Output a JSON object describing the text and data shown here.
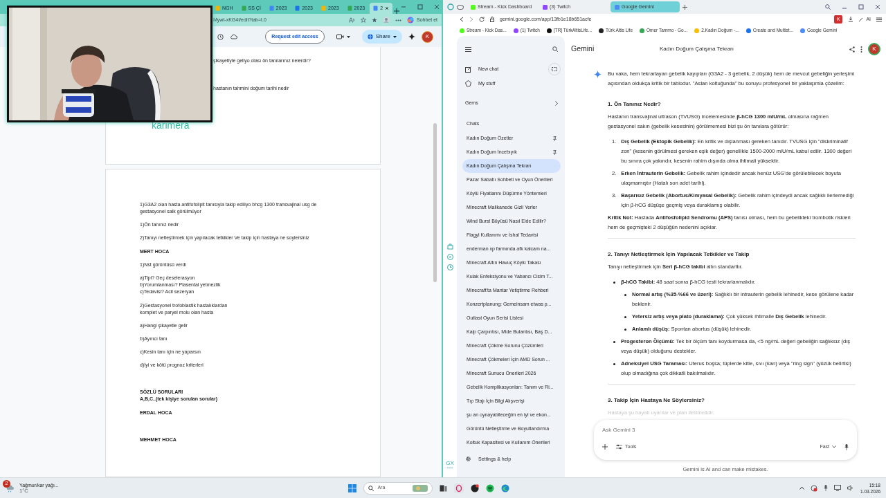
{
  "left_browser": {
    "tabs": [
      {
        "label": "NGH",
        "selected": false
      },
      {
        "label": "SS Çİ",
        "selected": false
      },
      {
        "label": "2023",
        "selected": false
      },
      {
        "label": "2023",
        "selected": false
      },
      {
        "label": "2023",
        "selected": false
      },
      {
        "label": "2023",
        "selected": false
      },
      {
        "label": "2",
        "selected": true
      }
    ],
    "url": "Mywt-xKG4I/edit?tab=t.0",
    "copilot_label": "Sohbet et"
  },
  "docs_toolbar": {
    "request_button": "Request edit access",
    "share_button": "Share",
    "avatar": "K"
  },
  "doc": {
    "page1_lines": [
      "şikayetiyle geliyo olası ön tanılarınız nelerdir?",
      "hastanın tahmini doğum tarihi nedir"
    ],
    "logo": "karimera",
    "page2_blocks": [
      {
        "kind": "para",
        "bold": false,
        "lines": [
          "1)G3A2 olan hasta antifofolipit tanısıyla takip ediliyo bhcg 1300 transvajinal usg de",
          "gestasyonel salk görülmüyor"
        ]
      },
      {
        "kind": "para",
        "bold": false,
        "lines": [
          "1)Ön tanınız nedir"
        ]
      },
      {
        "kind": "para",
        "bold": false,
        "lines": [
          "2)Tanıyı netleştirmek için yapılacak tetkikler Ve takip için hastaya ne soylersiniz"
        ]
      },
      {
        "kind": "section",
        "bold": true,
        "lines": [
          "MERT HOCA"
        ]
      },
      {
        "kind": "para",
        "bold": false,
        "lines": [
          "1)Nst görüntüsü verdi"
        ]
      },
      {
        "kind": "para",
        "bold": false,
        "lines": [
          "a)Tipi? Geç deselerasyon",
          "b)Yorumlanması? Plasental yetmezlik",
          "c)Tedavisi? Acil sezeryan"
        ]
      },
      {
        "kind": "section",
        "bold": false,
        "lines": [
          "2)Gestasyonel trofoblastik hastalıklardan",
          "komplet ve paryel molu olan hasta"
        ]
      },
      {
        "kind": "para",
        "bold": false,
        "lines": [
          "a)Hangi şikayetle gelir"
        ]
      },
      {
        "kind": "para",
        "bold": false,
        "lines": [
          "b)Ayırıcı tanı"
        ]
      },
      {
        "kind": "para",
        "bold": false,
        "lines": [
          "c)Kesin tanı için ne yaparsın"
        ]
      },
      {
        "kind": "para",
        "bold": false,
        "lines": [
          "d)İyi ve kötü prognoz kriterleri"
        ]
      },
      {
        "kind": "part",
        "bold": true,
        "lines": [
          "SÖZLÜ SORULARI",
          "A,B,C..(tek kişiye sorulan sorular)"
        ]
      },
      {
        "kind": "section",
        "bold": true,
        "lines": [
          "ERDAL HOCA"
        ]
      },
      {
        "kind": "part",
        "bold": true,
        "lines": [
          "MEHMET HOCA"
        ]
      }
    ]
  },
  "right_browser": {
    "tabs": [
      {
        "label": "Stream - Kick Dashboard",
        "selected": false
      },
      {
        "label": "(3) Twitch",
        "selected": false
      },
      {
        "label": "Google Gemini",
        "selected": true
      }
    ],
    "url": "gemini.google.com/app/13fb1e18b651acfe",
    "profile": "K",
    "ai_label": "AI",
    "side_label": "GX",
    "bookmarks": [
      "Stream - Kick Das...",
      "(1) Twitch",
      "[TR] TürkAltisLife...",
      "Türk Altis Life",
      "Ömer Tammo - Go...",
      "2.Kadın Doğum -...",
      "Create and Multist...",
      "Google Gemini"
    ]
  },
  "gemini": {
    "brand": "Gemini",
    "chat_title": "Kadın Doğum Çalışma Tekrarı",
    "avatar": "K",
    "sidebar": {
      "new_chat": "New chat",
      "my_stuff": "My stuff",
      "gems": "Gems",
      "chats_heading": "Chats",
      "settings": "Settings & help",
      "chats": [
        {
          "label": "Kadın Doğum Özetler",
          "pinned": true,
          "selected": false
        },
        {
          "label": "Kadın Doğum İncebıyık",
          "pinned": true,
          "selected": false
        },
        {
          "label": "Kadın Doğum Çalışma Tekrarı",
          "pinned": false,
          "selected": true
        },
        {
          "label": "Pazar Sabahı Sohbeti ve Oyun Önerileri",
          "pinned": false,
          "selected": false
        },
        {
          "label": "Köylü Fiyatlarını Düşürme Yöntemleri",
          "pinned": false,
          "selected": false
        },
        {
          "label": "Minecraft Malikanede Gizli Yerler",
          "pinned": false,
          "selected": false
        },
        {
          "label": "Wind Burst Büyüsü Nasıl Elde Edilir?",
          "pinned": false,
          "selected": false
        },
        {
          "label": "Flagyl Kullanımı ve İshal Tedavisi",
          "pinned": false,
          "selected": false
        },
        {
          "label": "enderman xp farmında afk kalcam na...",
          "pinned": false,
          "selected": false
        },
        {
          "label": "Minecraft Altın Havuç Köylü Takası",
          "pinned": false,
          "selected": false
        },
        {
          "label": "Kulak Enfeksiyonu ve Yabancı Cisim T...",
          "pinned": false,
          "selected": false
        },
        {
          "label": "Minecraft'ta Mantar Yetiştirme Rehberi",
          "pinned": false,
          "selected": false
        },
        {
          "label": "Konzertplanung: Gemeinsam etwas p...",
          "pinned": false,
          "selected": false
        },
        {
          "label": "Outlast Oyun Serisi Listesi",
          "pinned": false,
          "selected": false
        },
        {
          "label": "Kalp Çarpıntısı, Mide Bulantısı, Baş D...",
          "pinned": false,
          "selected": false
        },
        {
          "label": "Minecraft Çökme Sorunu Çözümleri",
          "pinned": false,
          "selected": false
        },
        {
          "label": "Minecraft Çökmeleri İçin AMD Sorun ...",
          "pinned": false,
          "selected": false
        },
        {
          "label": "Minecraft Sunucu Önerileri 2026",
          "pinned": false,
          "selected": false
        },
        {
          "label": "Gebelik Komplikasyonları: Tanım ve Ri...",
          "pinned": false,
          "selected": false
        },
        {
          "label": "Tıp Stajı İçin Bilgi Alışverişi",
          "pinned": false,
          "selected": false
        },
        {
          "label": "şu an oynayabileceğim en iyi ve ekon...",
          "pinned": false,
          "selected": false
        },
        {
          "label": "Görüntü Netleştirme ve Boyutlandırma",
          "pinned": false,
          "selected": false
        },
        {
          "label": "Koltuk Kapasitesi ve Kullanım Önerileri",
          "pinned": false,
          "selected": false
        }
      ]
    },
    "answer": [
      {
        "kind": "p",
        "text": "Bu vaka, hem tekrarlayan gebelik kayıpları (G3A2 - 3 gebelik, 2 düşük) hem de mevcut gebeliğin yerleşimi açısından oldukça kritik bir tablodur. \"Aslan koltuğunda\" bu soruyu profesyonel bir yaklaşımla çözelim:"
      },
      {
        "kind": "h",
        "text": "1. Ön Tanınız Nedir?"
      },
      {
        "kind": "p",
        "text": "Hastanın transvajinal ultrason (TVUSG) incelemesinde **β-hCG 1300 mIU/mL** olmasına rağmen gestasyonel sakın (gebelik kesesinin) görülmemesi bizi şu ön tanılara götürür:"
      },
      {
        "kind": "ol",
        "items": [
          {
            "marker": "1.",
            "text": "**Dış Gebelik (Ektopik Gebelik):** En kritik ve dışlanması gereken tanıdır. TVUSG için \"diskriminatif zon\" (kesenin görülmesi gereken eşik değer) genellikle 1500-2000 mIU/mL kabul edilir. 1300 değeri bu sınıra çok yakındır, kesenin rahim dışında olma ihtimali yüksektir."
          },
          {
            "marker": "2.",
            "text": "**Erken İntrauterin Gebelik:** Gebelik rahim içindedir ancak henüz USG'de görülebilecek boyuta ulaşmamıştır (Hatalı son adet tarihi)."
          },
          {
            "marker": "3.",
            "text": "**Başarısız Gebelik (Abortus/Kimyasal Gebelik):** Gebelik rahim içindeydi ancak sağlıklı ilerlemediği için β-hCG düşüşe geçmiş veya duraklamış olabilir."
          }
        ]
      },
      {
        "kind": "p",
        "text": "**Kritik Not:** Hastada **Antifosfolipid Sendromu (APS)** tanısı olması, hem bu gebelikteki trombotik riskleri hem de geçmişteki 2 düşüğün nedenini açıklar."
      },
      {
        "kind": "hr"
      },
      {
        "kind": "h",
        "text": "2. Tanıyı Netleştirmek İçin Yapılacak Tetkikler ve Takip"
      },
      {
        "kind": "p",
        "text": "Tanıyı netleştirmek için **Seri β-hCG takibi** altın standarttır."
      },
      {
        "kind": "ul",
        "items": [
          {
            "text": "**β-hCG Takibi:** 48 saat sonra β-hCG testi tekrarlanmalıdır.",
            "children": [
              {
                "text": "**Normal artış (%35-%66 ve üzeri):** Sağlıklı bir intrauterin gebelik lehinedir, kese görülene kadar beklenir."
              },
              {
                "text": "**Yetersiz artış veya plato (duraklama):** Çok yüksek ihtimalle **Dış Gebelik** lehinedir."
              },
              {
                "text": "**Anlamlı düşüş:** Spontan abortus (düşük) lehinedir."
              }
            ]
          },
          {
            "text": "**Progesteron Ölçümü:** Tek bir ölçüm tanı koydurmasa da, <5 ng/mL değeri gebeliğin sağlıksız (dış veya düşük) olduğunu destekler."
          },
          {
            "text": "**Adneksiyel USG Taraması:** Uterus boşsa; tüplerde kitle, sıvı (kan) veya \"ring sign\" (yüzük belirtisi) olup olmadığına çok dikkatli bakılmalıdır."
          }
        ]
      },
      {
        "kind": "hr"
      },
      {
        "kind": "h",
        "text": "3. Takip İçin Hastaya Ne Söylersiniz?"
      },
      {
        "kind": "faded",
        "text": "Hastaya şu hayati uyarılar ve plan iletilmelidir:"
      }
    ],
    "input": {
      "placeholder": "Ask Gemini 3",
      "tools": "Tools",
      "mode": "Fast"
    },
    "disclaimer": "Gemini is AI and can make mistakes."
  },
  "taskbar": {
    "weather": "Yağmur/kar yağı...",
    "temperature": "1°C",
    "badge": "2",
    "search_placeholder": "Ara",
    "time": "15:18",
    "date": "1.03.2026"
  }
}
